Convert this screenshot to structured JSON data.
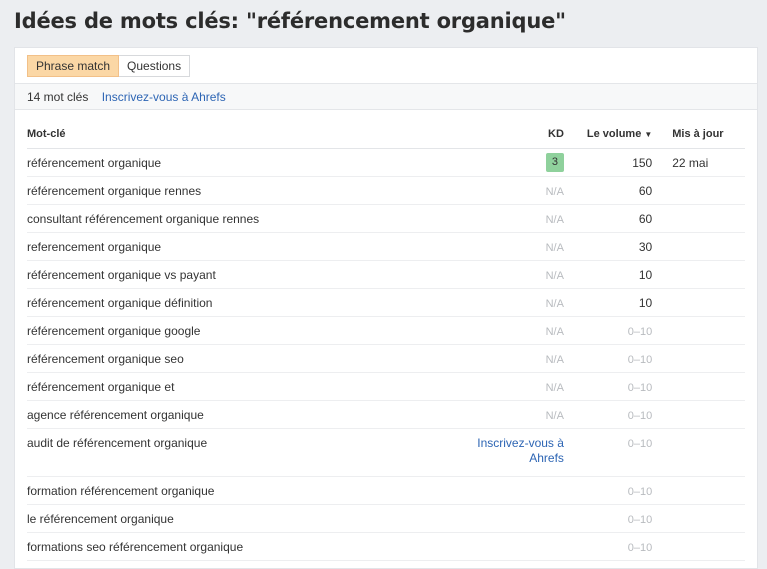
{
  "page": {
    "title": "Idées de mots clés: \"référencement organique\""
  },
  "tabs": [
    {
      "label": "Phrase match",
      "active": true
    },
    {
      "label": "Questions",
      "active": false
    }
  ],
  "summary": {
    "count_text": "14 mot clés",
    "signup_link": "Inscrivez-vous à Ahrefs"
  },
  "table": {
    "headers": {
      "keyword": "Mot-clé",
      "kd": "KD",
      "volume": "Le volume",
      "updated": "Mis à jour"
    },
    "rows": [
      {
        "keyword": "référencement organique",
        "kd": "3",
        "volume": "150",
        "updated": "22 mai"
      },
      {
        "keyword": "référencement organique rennes",
        "kd": "N/A",
        "volume": "60",
        "updated": ""
      },
      {
        "keyword": "consultant référencement organique rennes",
        "kd": "N/A",
        "volume": "60",
        "updated": ""
      },
      {
        "keyword": "referencement organique",
        "kd": "N/A",
        "volume": "30",
        "updated": ""
      },
      {
        "keyword": "référencement organique vs payant",
        "kd": "N/A",
        "volume": "10",
        "updated": ""
      },
      {
        "keyword": "référencement organique définition",
        "kd": "N/A",
        "volume": "10",
        "updated": ""
      },
      {
        "keyword": "référencement organique google",
        "kd": "N/A",
        "volume": "0–10",
        "updated": ""
      },
      {
        "keyword": "référencement organique seo",
        "kd": "N/A",
        "volume": "0–10",
        "updated": ""
      },
      {
        "keyword": "référencement organique et",
        "kd": "N/A",
        "volume": "0–10",
        "updated": ""
      },
      {
        "keyword": "agence référencement organique",
        "kd": "N/A",
        "volume": "0–10",
        "updated": ""
      },
      {
        "keyword": "audit de référencement organique",
        "kd": "Inscrivez-vous à Ahrefs",
        "volume": "0–10",
        "updated": ""
      },
      {
        "keyword": "formation référencement organique",
        "kd": "",
        "volume": "0–10",
        "updated": ""
      },
      {
        "keyword": "le référencement organique",
        "kd": "",
        "volume": "0–10",
        "updated": ""
      },
      {
        "keyword": "formations seo référencement organique",
        "kd": "",
        "volume": "0–10",
        "updated": ""
      }
    ]
  },
  "colors": {
    "active_tab": "#fbd7a5",
    "kd_badge": "#8fd19c",
    "link": "#2d65b4"
  }
}
